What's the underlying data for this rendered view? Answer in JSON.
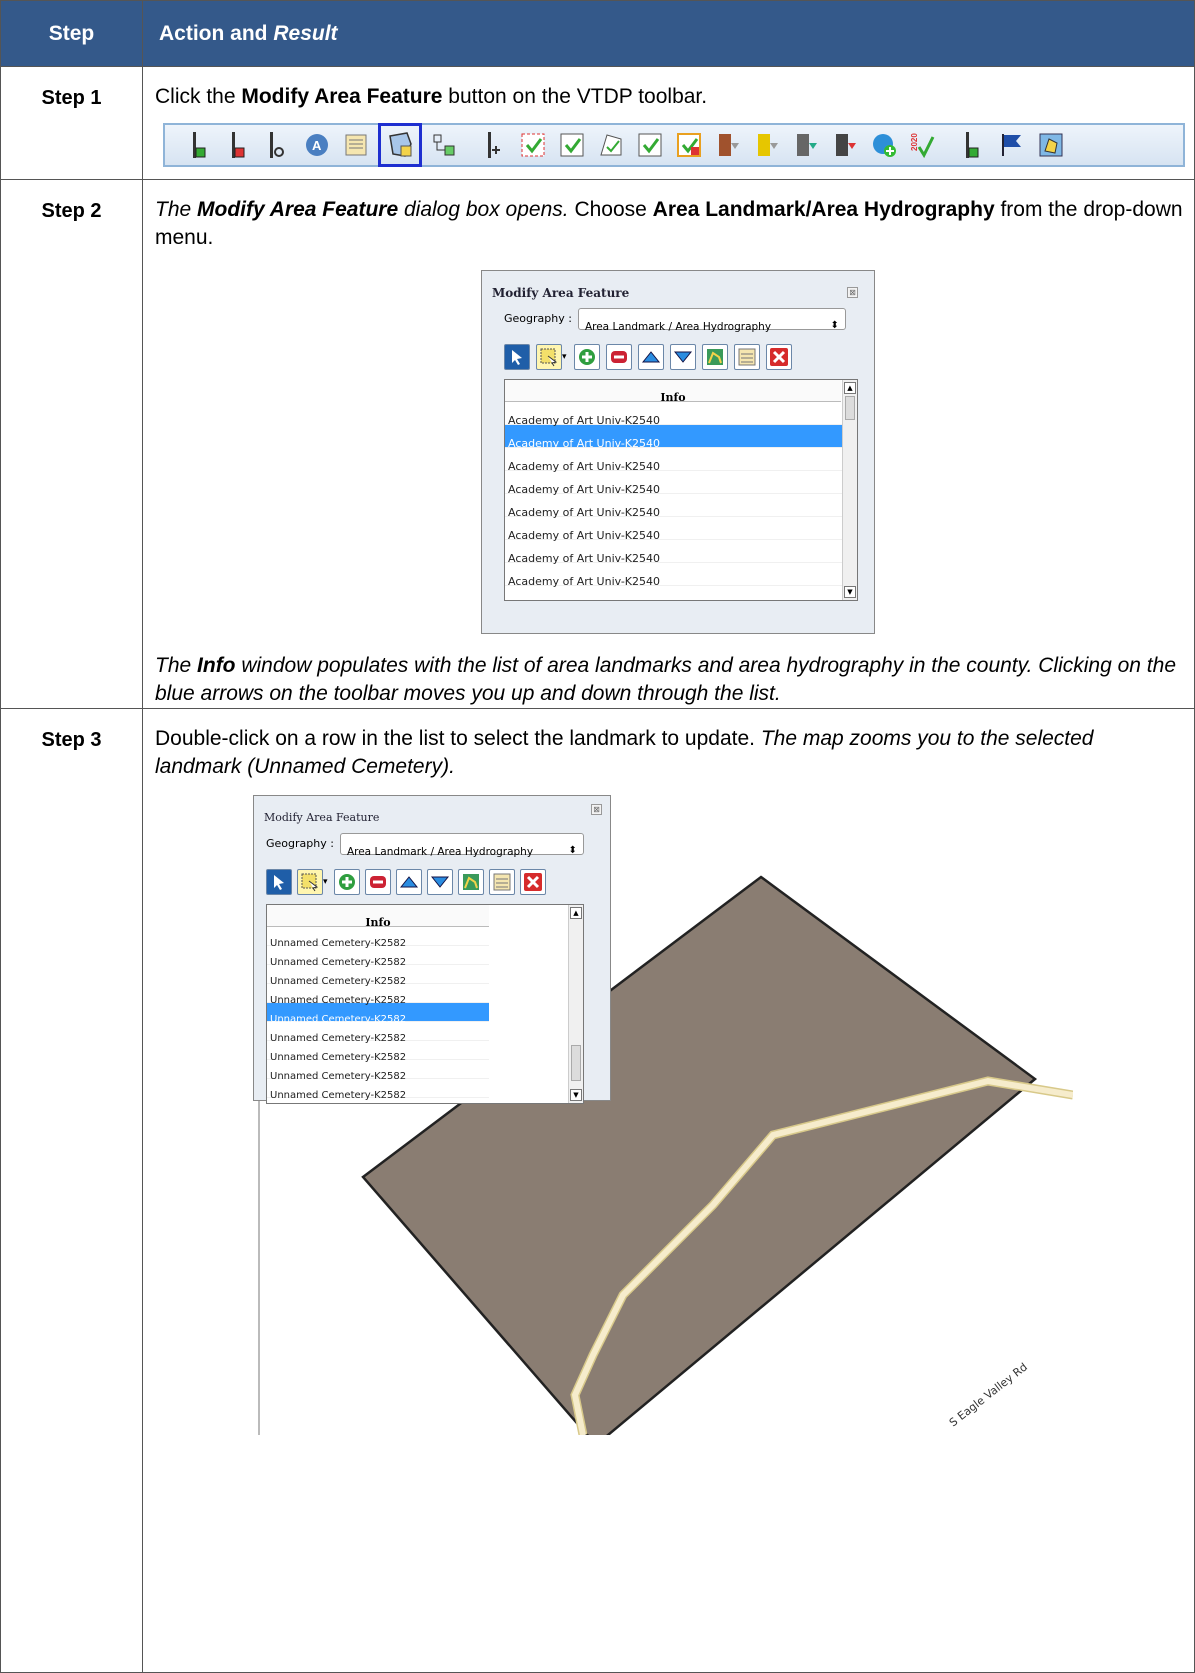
{
  "header": {
    "step": "Step",
    "action": "Action and",
    "result": "Result"
  },
  "steps": [
    {
      "label": "Step 1",
      "text_before": "Click the ",
      "bold": "Modify Area Feature",
      "text_after": " button on the VTDP toolbar."
    },
    {
      "label": "Step 2",
      "it1": "The ",
      "it_bold": "Modify Area Feature",
      "it2": " dialog box opens.",
      "t1": " Choose ",
      "bold": "Area Landmark/Area Hydrography",
      "t2": " from the drop-down menu.",
      "after_it1": "The ",
      "after_bold": "Info",
      "after_it2": " window populates with the list of area landmarks and area hydrography in the county. Clicking on the blue arrows on the toolbar moves you up and down through the list."
    },
    {
      "label": "Step 3",
      "t1": "Double-click on a row in the list to select the landmark to update. ",
      "it": "The map zooms you to the selected landmark (Unnamed Cemetery)."
    }
  ],
  "dialog2": {
    "title": "Modify Area Feature",
    "geo_label": "Geography :",
    "geo_value": "Area Landmark / Area Hydrography",
    "column": "Info",
    "rows": [
      "Academy of Art Univ-K2540",
      "Academy of Art Univ-K2540",
      "Academy of Art Univ-K2540",
      "Academy of Art Univ-K2540",
      "Academy of Art Univ-K2540",
      "Academy of Art Univ-K2540",
      "Academy of Art Univ-K2540",
      "Academy of Art Univ-K2540",
      "Academy of Art Univ-K2540"
    ],
    "selected_index": 1
  },
  "dialog3": {
    "title": "Modify Area Feature",
    "geo_label": "Geography :",
    "geo_value": "Area Landmark / Area Hydrography",
    "column": "Info",
    "rows": [
      "Unnamed Cemetery-K2582",
      "Unnamed Cemetery-K2582",
      "Unnamed Cemetery-K2582",
      "Unnamed Cemetery-K2582",
      "Unnamed Cemetery-K2582",
      "Unnamed Cemetery-K2582",
      "Unnamed Cemetery-K2582",
      "Unnamed Cemetery-K2582",
      "Unnamed Cemetery-K2582"
    ],
    "selected_index": 4
  },
  "map": {
    "road_label": "S Eagle Valley Rd",
    "polygon_color": "#8a7d72",
    "road_color": "#f2e3b3"
  },
  "icons": [
    "add-line-icon",
    "delete-line-icon",
    "split-line-icon",
    "address-icon",
    "attribute-table-icon",
    "modify-area-feature-icon",
    "topology-icon",
    "line-tool-icon",
    "review-icon",
    "validate-icon",
    "shape-check-icon",
    "check-icon",
    "export-icon",
    "build-icon",
    "import-icon",
    "layers-icon",
    "report-icon",
    "globe-add-icon",
    "census-2020-icon",
    "add-point-icon",
    "flag-icon",
    "map-view-icon"
  ]
}
